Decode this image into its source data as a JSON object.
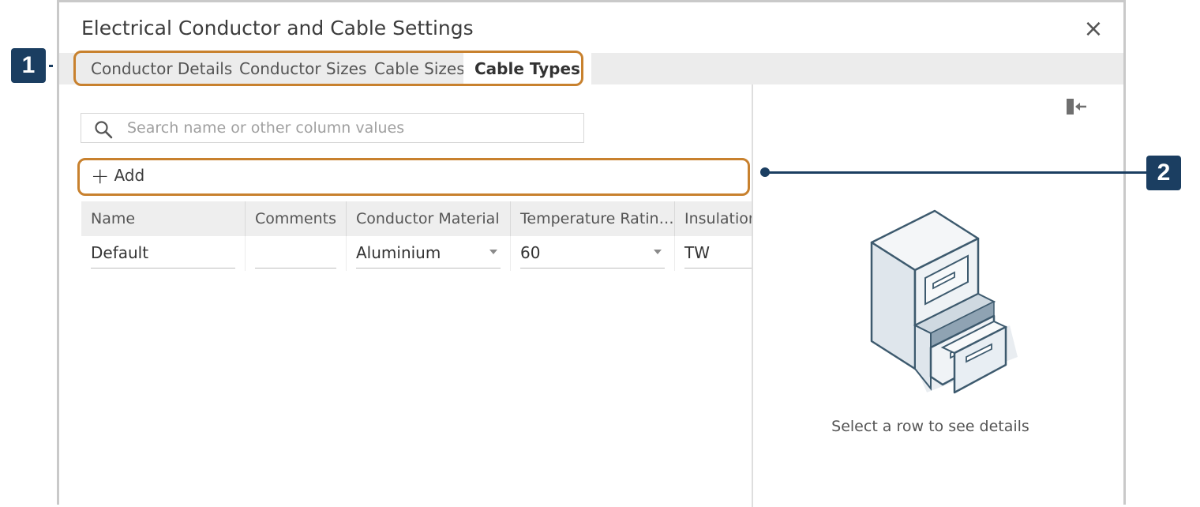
{
  "dialog": {
    "title": "Electrical Conductor and Cable Settings",
    "close_label": "×"
  },
  "tabs": [
    {
      "label": "Conductor Details",
      "active": false
    },
    {
      "label": "Conductor Sizes",
      "active": false
    },
    {
      "label": "Cable Sizes",
      "active": false
    },
    {
      "label": "Cable Types",
      "active": true
    }
  ],
  "search": {
    "placeholder": "Search name or other column values",
    "icon": "search-icon"
  },
  "toolbar": {
    "add_label": "Add",
    "add_icon": "plus-icon"
  },
  "table": {
    "columns": [
      "Name",
      "Comments",
      "Conductor Material",
      "Temperature Ratin…",
      "Insulation"
    ],
    "rows": [
      {
        "name": "Default",
        "comments": "",
        "material": "Aluminium",
        "temperature": "60",
        "insulation": "TW"
      }
    ]
  },
  "details_panel": {
    "empty_message": "Select a row to see details",
    "collapse_icon": "collapse-panel-icon",
    "illustration": "empty-drawer-cabinet-illustration"
  },
  "callouts": [
    {
      "number": "1"
    },
    {
      "number": "2"
    }
  ],
  "colors": {
    "highlight": "#c8812e",
    "callout": "#1b3e61",
    "tabbar": "#ececec"
  }
}
